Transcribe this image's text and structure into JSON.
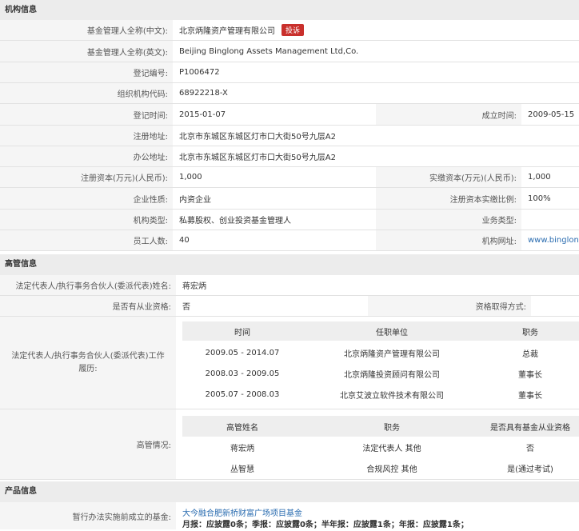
{
  "org": {
    "title": "机构信息",
    "name_cn_label": "基金管理人全称(中文):",
    "name_cn": "北京炳隆资产管理有限公司",
    "complaint": "投诉",
    "name_en_label": "基金管理人全称(英文):",
    "name_en": "Beijing Binglong Assets Management Ltd,Co.",
    "reg_no_label": "登记编号:",
    "reg_no": "P1006472",
    "org_code_label": "组织机构代码:",
    "org_code": "68922218-X",
    "reg_date_label": "登记时间:",
    "reg_date": "2015-01-07",
    "est_date_label": "成立时间:",
    "est_date": "2009-05-15",
    "reg_addr_label": "注册地址:",
    "reg_addr": "北京市东城区东城区灯市口大街50号九层A2",
    "office_addr_label": "办公地址:",
    "office_addr": "北京市东城区东城区灯市口大街50号九层A2",
    "reg_capital_label": "注册资本(万元)(人民币):",
    "reg_capital": "1,000",
    "paid_capital_label": "实缴资本(万元)(人民币):",
    "paid_capital": "1,000",
    "nature_label": "企业性质:",
    "nature": "内资企业",
    "paid_ratio_label": "注册资本实缴比例:",
    "paid_ratio": "100%",
    "type_label": "机构类型:",
    "type": "私募股权、创业投资基金管理人",
    "biz_type_label": "业务类型:",
    "biz_type": "",
    "staff_label": "员工人数:",
    "staff": "40",
    "website_label": "机构网址:",
    "website": "www.binglon"
  },
  "exec": {
    "title": "高管信息",
    "legal_rep_label": "法定代表人/执行事务合伙人(委派代表)姓名:",
    "legal_rep": "蒋宏炳",
    "qualified_label": "是否有从业资格:",
    "qualified": "否",
    "qual_method_label": "资格取得方式:",
    "qual_method": "",
    "history_label": "法定代表人/执行事务合伙人(委派代表)工作履历:",
    "history_headers": [
      "时间",
      "任职单位",
      "职务"
    ],
    "history": [
      [
        "2009.05 - 2014.07",
        "北京炳隆资产管理有限公司",
        "总裁"
      ],
      [
        "2008.03 - 2009.05",
        "北京炳隆投资顾问有限公司",
        "董事长"
      ],
      [
        "2005.07 - 2008.03",
        "北京艾波立软件技术有限公司",
        "董事长"
      ]
    ],
    "managers_label": "高管情况:",
    "managers_headers": [
      "高管姓名",
      "职务",
      "是否具有基金从业资格"
    ],
    "managers": [
      [
        "蒋宏炳",
        "法定代表人 其他",
        "否"
      ],
      [
        "丛智慧",
        "合规风控 其他",
        "是(通过考试)"
      ]
    ]
  },
  "product": {
    "title": "产品信息",
    "pre_fund_label": "暂行办法实施前成立的基金:",
    "pre_fund_name": "大今融合肥新桥财富广场项目基金",
    "pre_fund_reports": "月报：应披露0条；季报：应披露0条；半年报：应披露1条；年报：应披露1条；"
  }
}
